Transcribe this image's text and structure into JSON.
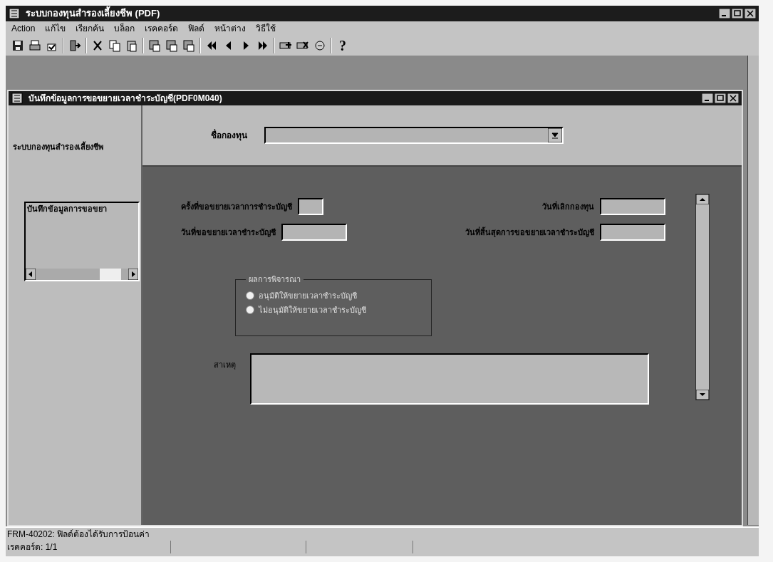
{
  "window": {
    "title": "ระบบกองทุนสำรองเลี้ยงชีพ (PDF)"
  },
  "menu": [
    "Action",
    "แก้ไข",
    "เรียกค้น",
    "บล็อก",
    "เรคคอร์ด",
    "ฟิลด์",
    "หน้าต่าง",
    "วิธีใช้"
  ],
  "toolbar": {
    "help_label": "?"
  },
  "form": {
    "title": "บันทึกข้อมูลการขอขยายเวลาชำระบัญชี(PDF0M040)",
    "sidebar": {
      "title": "ระบบกองทุนสำรองเลี้ยงชีพ",
      "items": [
        {
          "label": "บันทึกข้อมูลการขอขยา",
          "selected": false
        }
      ]
    },
    "fund_name": {
      "label": "ชื่อกองทุน"
    },
    "fields": [
      {
        "label": "ครั้งที่ขอขยายเวลาการชำระบัญชี",
        "kind": "number"
      },
      {
        "label": "วันที่เลิกกองทุน",
        "kind": "date"
      },
      {
        "label": "วันที่ขอขยายเวลาชำระบัญชี",
        "kind": "date"
      },
      {
        "label": "วันที่สิ้นสุดการขอขยายเวลาชำระบัญชี",
        "kind": "date"
      }
    ],
    "decision": {
      "title": "ผลการพิจารณา",
      "options": [
        {
          "label": "อนุมัติให้ขยายเวลาชำระบัญชี",
          "selected": false
        },
        {
          "label": "ไม่อนุมัติให้ขยายเวลาชำระบัญชี",
          "selected": false
        }
      ]
    },
    "reason": {
      "label": "สาเหตุ"
    }
  },
  "status_bar": {
    "message": "FRM-40202: ฟิลด์ต้องได้รับการป้อนค่า",
    "record": "เรคคอร์ด: 1/1"
  }
}
